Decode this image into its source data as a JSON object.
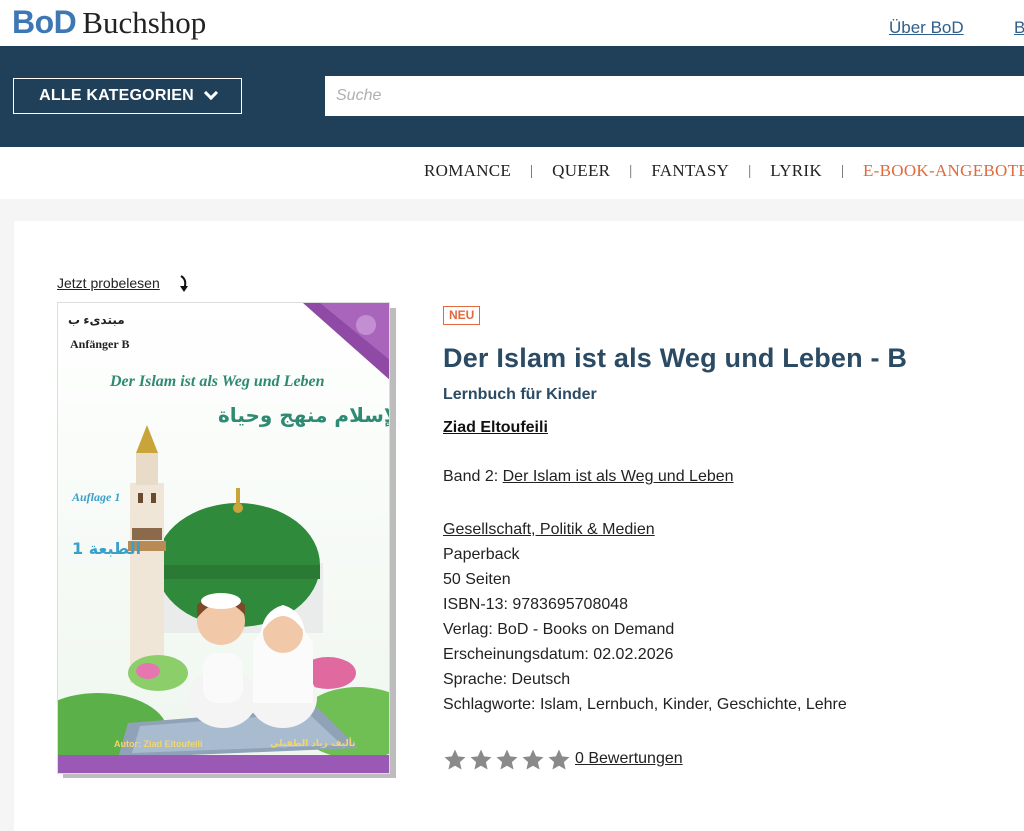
{
  "header": {
    "logo_bod": "BoD",
    "logo_shop": "Buchshop",
    "links": [
      "Über BoD",
      "B"
    ]
  },
  "nav": {
    "categories_button": "ALLE KATEGORIEN",
    "search_placeholder": "Suche"
  },
  "category_strip": [
    "ROMANCE",
    "QUEER",
    "FANTASY",
    "LYRIK",
    "E-BOOK-ANGEBOTE %"
  ],
  "preview_link": "Jetzt probelesen",
  "cover": {
    "series": "مبتدىء ب",
    "level": "Anfänger B",
    "title": "Der Islam ist als Weg und Leben",
    "title_ar": "الإسلام منهج وحياة",
    "edition": "Auflage 1",
    "edition_ar": "الطبعة 1",
    "author": "Autor: Ziad Eltoufeili",
    "author_ar": "تأليف زياد الطفيلي"
  },
  "product": {
    "badge": "NEU",
    "title": "Der Islam ist als Weg und Leben - B",
    "subtitle": "Lernbuch für Kinder",
    "author": "Ziad Eltoufeili",
    "band_prefix": "Band 2: ",
    "band_link": "Der Islam ist als Weg und Leben",
    "category_link": "Gesellschaft, Politik & Medien",
    "format": "Paperback",
    "pages": "50 Seiten",
    "isbn": "ISBN-13: 9783695708048",
    "publisher": "Verlag: BoD - Books on Demand",
    "release": "Erscheinungsdatum: 02.02.2026",
    "language": "Sprache: Deutsch",
    "keywords": "Schlagworte: Islam, Lernbuch, Kinder, Geschichte, Lehre",
    "rating": 0,
    "rating_max": 5,
    "reviews_link": "0 Bewertungen"
  },
  "colors": {
    "nav_bg": "#1f4058",
    "title": "#2b4a63",
    "accent": "#e06a3c",
    "logo_blue": "#3d78b4",
    "star_empty": "#8a8a8a"
  }
}
